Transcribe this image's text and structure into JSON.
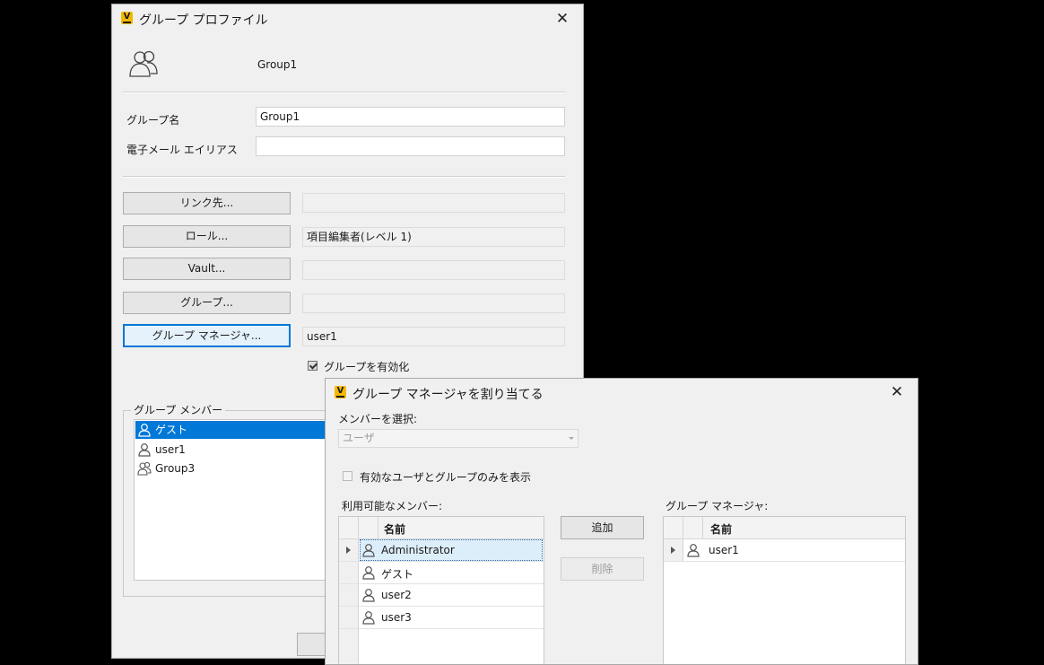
{
  "profile_dialog": {
    "title": "グループ プロファイル",
    "header_name": "Group1",
    "group_name_label": "グループ名",
    "group_name_value": "Group1",
    "email_label": "電子メール エイリアス",
    "email_value": "",
    "link_button": "リンク先...",
    "link_value": "",
    "role_button": "ロール...",
    "role_value": "項目編集者(レベル 1)",
    "vault_button": "Vault...",
    "vault_value": "",
    "group_button": "グループ...",
    "group_value": "",
    "manager_button": "グループ マネージャ...",
    "manager_value": "user1",
    "enable_label": "グループを有効化",
    "enable_checked": true,
    "members_title": "グループ メンバー",
    "members": [
      {
        "name": "ゲスト",
        "icon": "user-icon",
        "selected": true
      },
      {
        "name": "user1",
        "icon": "user-icon",
        "selected": false
      },
      {
        "name": "Group3",
        "icon": "group-icon",
        "selected": false
      }
    ]
  },
  "assign_dialog": {
    "title": "グループ マネージャを割り当てる",
    "select_member_label": "メンバーを選択:",
    "member_type_value": "ユーザ",
    "only_active_label": "有効なユーザとグループのみを表示",
    "only_active_checked": false,
    "available_label": "利用可能なメンバー:",
    "available_header": "名前",
    "available": [
      {
        "name": "Administrator",
        "selected": true,
        "expandable": true
      },
      {
        "name": "ゲスト",
        "selected": false,
        "expandable": false
      },
      {
        "name": "user2",
        "selected": false,
        "expandable": false
      },
      {
        "name": "user3",
        "selected": false,
        "expandable": false
      }
    ],
    "add_button": "追加",
    "remove_button": "削除",
    "managers_label": "グループ マネージャ:",
    "managers_header": "名前",
    "managers": [
      {
        "name": "user1",
        "expandable": true
      }
    ]
  },
  "colors": {
    "accent": "#0078d7",
    "selection_light": "#ddeefb",
    "dialog_bg": "#f0f0f0",
    "app_logo": "#f5b800"
  }
}
